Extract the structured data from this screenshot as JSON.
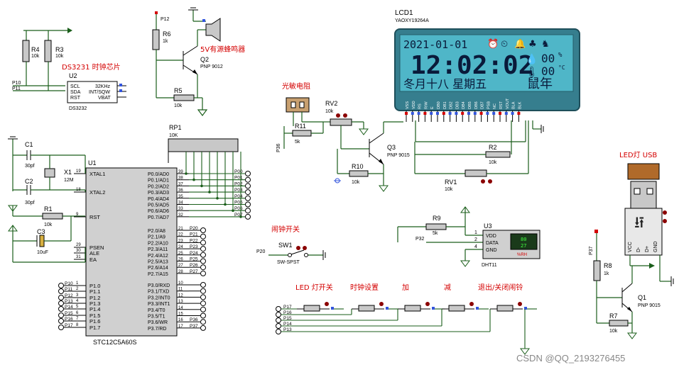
{
  "components": {
    "ds3231_label": "DS3231 时钟芯片",
    "u2_ref": "U2",
    "u2_part": "DS3232",
    "u2_pins_left": [
      "SCL",
      "SDA",
      "RST"
    ],
    "u2_pins_right": [
      "32KHz",
      "INT/SQW",
      "VBAT"
    ],
    "r4": {
      "ref": "R4",
      "val": "10k"
    },
    "r3": {
      "ref": "R3",
      "val": "10k"
    },
    "p10": "P10",
    "p11": "P11",
    "pin_nums_u2": [
      "16",
      "15",
      "5",
      "3",
      "4",
      "14"
    ],
    "buzzer_label": "5V有源蜂鸣器",
    "p12": "P12",
    "r6": {
      "ref": "R6",
      "val": "1k"
    },
    "q2": {
      "ref": "Q2",
      "val": "PNP 9012"
    },
    "r5": {
      "ref": "R5",
      "val": "10k"
    },
    "lcd_ref": "LCD1",
    "lcd_part": "YAOXY19264A",
    "lcd_date": "2021-01-01",
    "lcd_time": "12:02:02",
    "lcd_line3": "冬月十八  星期五",
    "lcd_year": "鼠年",
    "lcd_temp1": "00",
    "lcd_temp2": "00",
    "lcd_pct": "%",
    "lcd_degc": "°C",
    "lcd_pins": [
      "VSS",
      "VDD",
      "RS",
      "R/W",
      "E",
      "DB0",
      "DB1",
      "DB2",
      "DB3",
      "DB4",
      "DB5",
      "DB6",
      "DB7",
      "PSB",
      "NC",
      "RST",
      "VOUT",
      "BLA",
      "BLK"
    ],
    "light_label": "光敏电阻",
    "rv2": {
      "ref": "RV2",
      "val": "10k"
    },
    "r11": {
      "ref": "R11",
      "val": "5k"
    },
    "p36": "P36",
    "q3": {
      "ref": "Q3",
      "val": "PNP 9015"
    },
    "r10": {
      "ref": "R10",
      "val": "10k"
    },
    "r2": {
      "ref": "R2",
      "val": "10k"
    },
    "rv1": {
      "ref": "RV1",
      "val": "10k"
    },
    "rp1": {
      "ref": "RP1",
      "val": "10K"
    },
    "c1": {
      "ref": "C1",
      "val": "30pf"
    },
    "x1": {
      "ref": "X1",
      "val": "12M"
    },
    "c2": {
      "ref": "C2",
      "val": "30pf"
    },
    "r1": {
      "ref": "R1",
      "val": "10k"
    },
    "c3": {
      "ref": "C3",
      "val": "10uF"
    },
    "u1_ref": "U1",
    "u1_part": "STC12C5A60S",
    "u1_left": [
      "XTAL1",
      "XTAL2",
      "RST",
      "PSEN",
      "ALE",
      "EA",
      "P1.0",
      "P1.1",
      "P1.2",
      "P1.3",
      "P1.4",
      "P1.5",
      "P1.6",
      "P1.7"
    ],
    "u1_left_nums": [
      "19",
      "18",
      "9",
      "29",
      "30",
      "31",
      "1",
      "2",
      "3",
      "4",
      "5",
      "6",
      "7",
      "8"
    ],
    "u1_right_p0": [
      "P0.0/AD0",
      "P0.1/AD1",
      "P0.2/AD2",
      "P0.3/AD3",
      "P0.4/AD4",
      "P0.5/AD5",
      "P0.6/AD6",
      "P0.7/AD7"
    ],
    "u1_right_p0_nums": [
      "39",
      "38",
      "37",
      "36",
      "35",
      "34",
      "33",
      "32"
    ],
    "u1_right_p2": [
      "P2.0/A8",
      "P2.1/A9",
      "P2.2/A10",
      "P2.3/A11",
      "P2.4/A12",
      "P2.5/A13",
      "P2.6/A14",
      "P2.7/A15"
    ],
    "u1_right_p2_nums": [
      "21",
      "22",
      "23",
      "24",
      "25",
      "26",
      "27",
      "28"
    ],
    "u1_right_p3": [
      "P3.0/RXD",
      "P3.1/TXD",
      "P3.2/INT0",
      "P3.3/INT1",
      "P3.4/T0",
      "P3.5/T1",
      "P3.6/WR",
      "P3.7/RD"
    ],
    "u1_right_p3_nums": [
      "10",
      "11",
      "12",
      "13",
      "14",
      "15",
      "16",
      "17"
    ],
    "p0_nets": [
      "P00",
      "P01",
      "P02",
      "P03",
      "P04",
      "P05",
      "P06",
      "P07"
    ],
    "p2_nets": [
      "P20",
      "P21",
      "P22",
      "P23",
      "P24",
      "P25",
      "P26",
      "P27"
    ],
    "p1_nets": [
      "P10",
      "P11",
      "P12",
      "P13",
      "P14",
      "P15",
      "P16",
      "P17"
    ],
    "p3_nets": [
      "P36",
      "P37"
    ],
    "alarm_switch_label": "闹钟开关",
    "sw1": {
      "ref": "SW1",
      "val": "SW-SPST"
    },
    "p20": "P20",
    "r9": {
      "ref": "R9",
      "val": "5k"
    },
    "p32": "P32",
    "u3": {
      "ref": "U3",
      "val": "DHT11",
      "pins": [
        "VDD",
        "DATA",
        "GND"
      ],
      "pin_nums": [
        "1",
        "2",
        "4"
      ],
      "disp1": "80",
      "disp2": "27",
      "unit": "%RH"
    },
    "led_usb_label": "LED灯 USB",
    "usb_pins": [
      "VCC",
      "D-",
      "D+",
      "GND"
    ],
    "p37": "P37",
    "r8": {
      "ref": "R8",
      "val": "1k"
    },
    "r7": {
      "ref": "R7",
      "val": "10k"
    },
    "q1": {
      "ref": "Q1",
      "val": "PNP 9015"
    },
    "btn_labels": [
      "LED 灯开关",
      "时钟设置",
      "加",
      "减",
      "退出/关闭闹铃"
    ],
    "btn_nets": [
      "P17",
      "P16",
      "P15",
      "P14",
      "P13"
    ],
    "watermark": "CSDN @QQ_2193276455"
  }
}
